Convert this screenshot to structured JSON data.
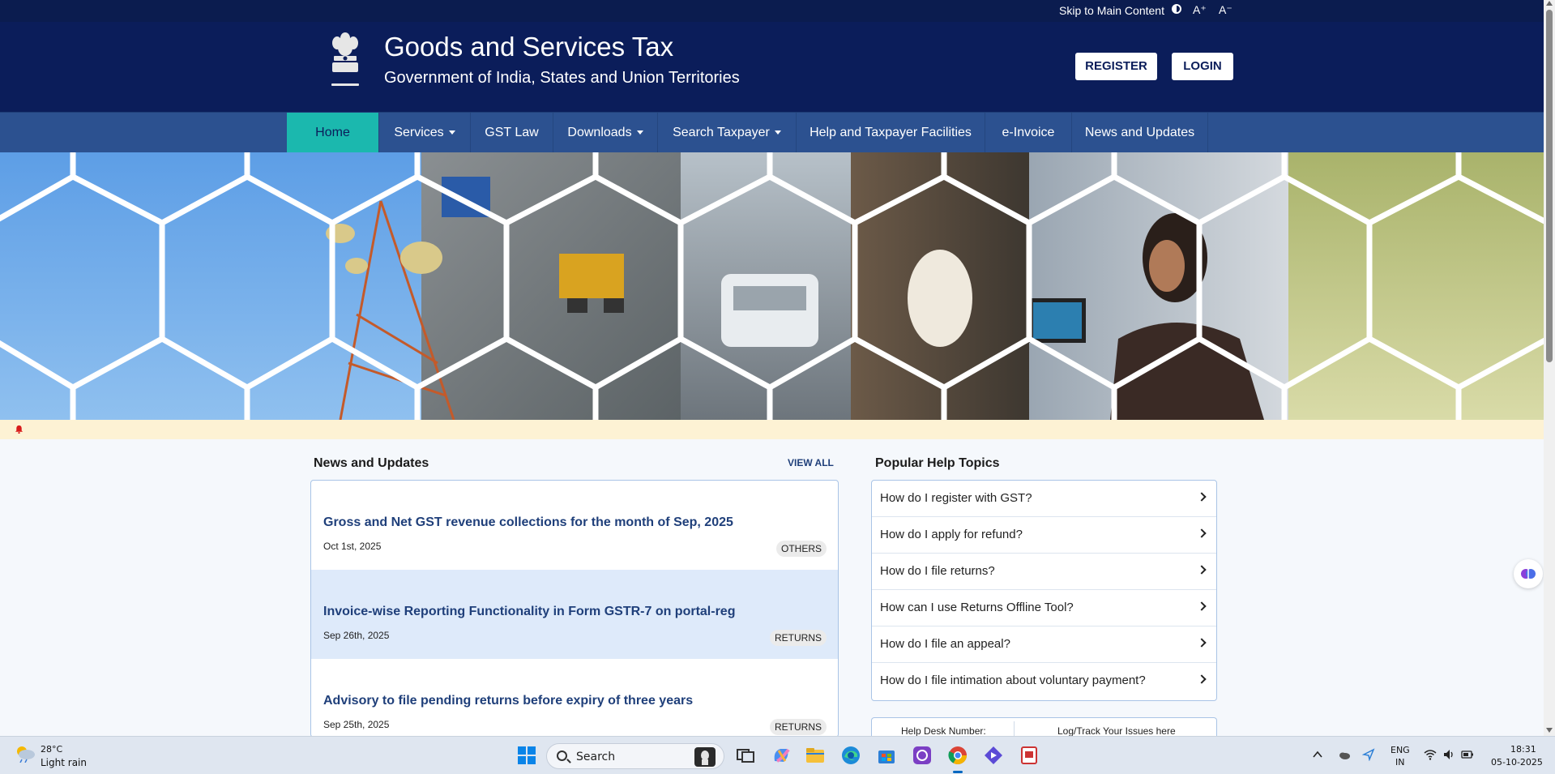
{
  "utility": {
    "skip": "Skip to Main Content",
    "font_increase": "A⁺",
    "font_decrease": "A⁻"
  },
  "header": {
    "title": "Goods and Services Tax",
    "subtitle": "Government of India, States and Union Territories",
    "register": "REGISTER",
    "login": "LOGIN"
  },
  "nav": {
    "home": "Home",
    "services": "Services",
    "gst_law": "GST Law",
    "downloads": "Downloads",
    "search_taxpayer": "Search Taxpayer",
    "help": "Help and Taxpayer Facilities",
    "einvoice": "e-Invoice",
    "news": "News and Updates"
  },
  "news": {
    "heading": "News and Updates",
    "view_all": "VIEW ALL",
    "items": [
      {
        "title": "Gross and Net GST revenue collections for the month of Sep, 2025",
        "date": "Oct 1st, 2025",
        "tag": "OTHERS"
      },
      {
        "title": "Invoice-wise Reporting Functionality in Form GSTR-7 on portal-reg",
        "date": "Sep 26th, 2025",
        "tag": "RETURNS"
      },
      {
        "title": "Advisory to file pending returns before expiry of three years",
        "date": "Sep 25th, 2025",
        "tag": "RETURNS"
      }
    ]
  },
  "help": {
    "heading": "Popular Help Topics",
    "items": [
      "How do I register with GST?",
      "How do I apply for refund?",
      "How do I file returns?",
      "How can I use Returns Offline Tool?",
      "How do I file an appeal?",
      "How do I file intimation about voluntary payment?"
    ],
    "helpdesk": "Help Desk Number:",
    "log_issues": "Log/Track Your Issues here"
  },
  "taskbar": {
    "temp": "28°C",
    "weather": "Light rain",
    "search": "Search",
    "lang1": "ENG",
    "lang2": "IN",
    "time": "18:31",
    "date": "05-10-2025"
  },
  "colors": {
    "header_bg": "#0b1d5a",
    "nav_bg": "#2c5190",
    "nav_active": "#1bb8ae",
    "news_title": "#1f3f7a"
  }
}
